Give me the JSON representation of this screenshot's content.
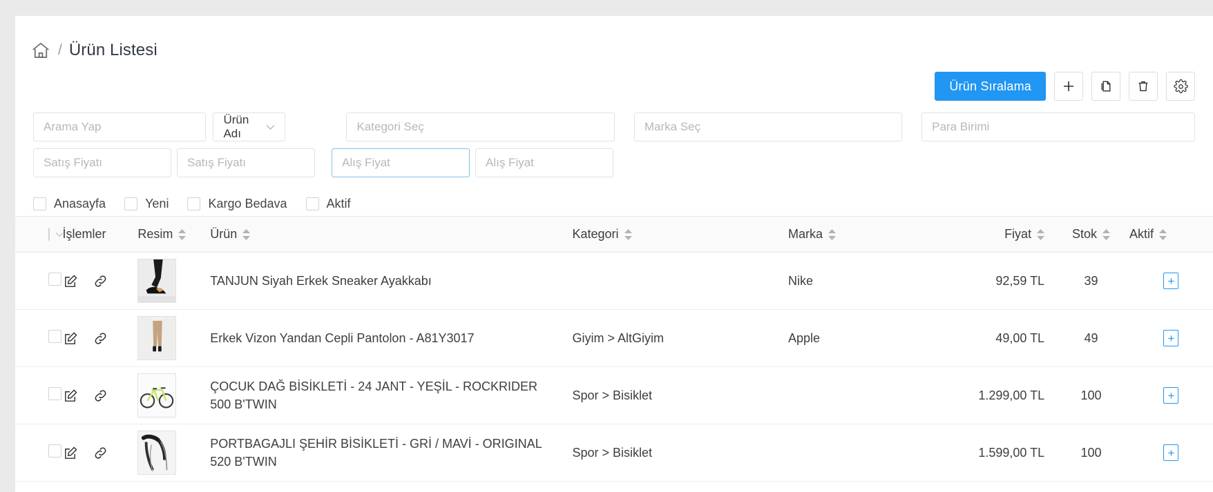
{
  "breadcrumb": {
    "home_icon": "home-icon",
    "separator": "/",
    "title": "Ürün Listesi"
  },
  "toolbar": {
    "primary_label": "Ürün Sıralama",
    "buttons": [
      {
        "name": "add-button",
        "icon": "plus-icon"
      },
      {
        "name": "duplicate-button",
        "icon": "copy-icon"
      },
      {
        "name": "delete-button",
        "icon": "trash-icon"
      },
      {
        "name": "settings-button",
        "icon": "gear-icon"
      }
    ],
    "accent_color": "#2196f3"
  },
  "filters": {
    "search_placeholder": "Arama Yap",
    "search_value": "",
    "search_field_selected": "Ürün Adı",
    "search_field_options": [
      "Ürün Adı"
    ],
    "kategori_placeholder": "Kategori Seç",
    "marka_placeholder": "Marka Seç",
    "para_birimi_placeholder": "Para Birimi",
    "satis_fiyati_min_placeholder": "Satış Fiyatı",
    "satis_fiyati_max_placeholder": "Satış Fiyatı",
    "alis_fiyat_min_placeholder": "Alış Fiyat",
    "alis_fiyat_max_placeholder": "Alış Fiyat",
    "focused_field": "alis_fiyat_min",
    "focus_border_color": "#7cc0ea"
  },
  "checkboxes": [
    {
      "label": "Anasayfa",
      "checked": false
    },
    {
      "label": "Yeni",
      "checked": false
    },
    {
      "label": "Kargo Bedava",
      "checked": false
    },
    {
      "label": "Aktif",
      "checked": false
    }
  ],
  "table": {
    "headers": {
      "select_all": "",
      "islemler": "İşlemler",
      "resim": "Resim",
      "urun": "Ürün",
      "kategori": "Kategori",
      "marka": "Marka",
      "fiyat": "Fiyat",
      "stok": "Stok",
      "aktif": "Aktif"
    },
    "rows": [
      {
        "urun": "TANJUN Siyah Erkek Sneaker Ayakkabı",
        "kategori": "",
        "marka": "Nike",
        "fiyat": "92,59 TL",
        "stok": "39",
        "aktif": "+",
        "thumb": "sneaker-thumbnail",
        "checked": false
      },
      {
        "urun": "Erkek Vizon Yandan Cepli Pantolon - A81Y3017",
        "kategori": "Giyim > AltGiyim",
        "marka": "Apple",
        "fiyat": "49,00 TL",
        "stok": "49",
        "aktif": "+",
        "thumb": "pants-thumbnail",
        "checked": false
      },
      {
        "urun": "ÇOCUK DAĞ BİSİKLETİ - 24 JANT - YEŞİL - ROCKRIDER 500 B'TWIN",
        "kategori": "Spor > Bisiklet",
        "marka": "",
        "fiyat": "1.299,00 TL",
        "stok": "100",
        "aktif": "+",
        "thumb": "bicycle-thumbnail",
        "checked": false
      },
      {
        "urun": "PORTBAGAJLI ŞEHİR BİSİKLETİ - GRİ / MAVİ - ORIGINAL 520 B'TWIN",
        "kategori": "Spor > Bisiklet",
        "marka": "",
        "fiyat": "1.599,00 TL",
        "stok": "100",
        "aktif": "+",
        "thumb": "handlebar-thumbnail",
        "checked": false
      }
    ],
    "row_action_icons": [
      "edit-icon",
      "link-icon"
    ]
  }
}
